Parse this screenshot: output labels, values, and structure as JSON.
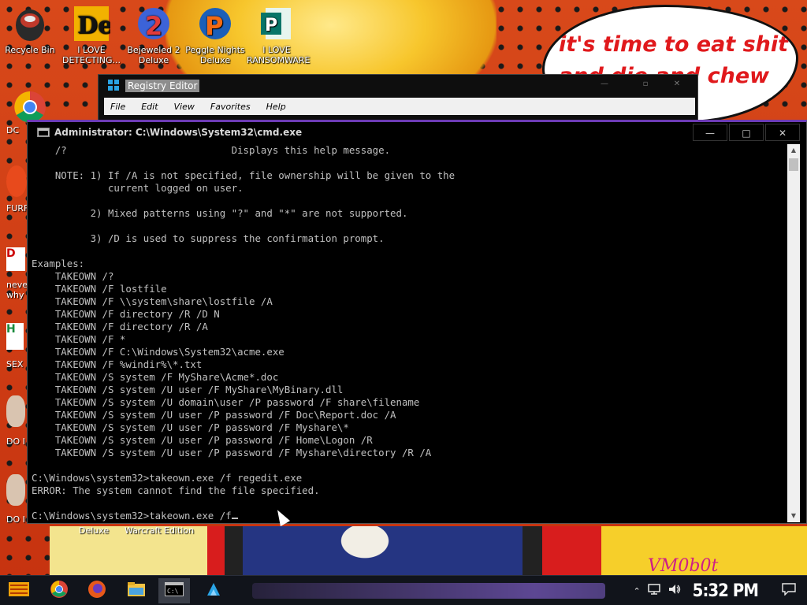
{
  "wallpaper": {
    "speech_text": "it's time to eat shit and die and chew",
    "signature": "VM0b0t",
    "under_labels": [
      "Deluxe",
      "Warcraft Edition"
    ]
  },
  "desktop_icons": [
    {
      "label": "Recycle Bin",
      "icon": "recycle-bin-icon"
    },
    {
      "label": "I LOVE DETECTING...",
      "icon": "detecting-app-icon"
    },
    {
      "label": "Bejeweled 2 Deluxe",
      "icon": "bejeweled-icon"
    },
    {
      "label": "Peggle Nights Deluxe",
      "icon": "peggle-icon"
    },
    {
      "label": "I LOVE RANSOMWARE",
      "icon": "publisher-icon"
    }
  ],
  "partial_icons": [
    "DC",
    "FURF",
    "neve why",
    "SEX",
    "DO I",
    "DO I"
  ],
  "regedit": {
    "title": "Registry Editor",
    "menu": [
      "File",
      "Edit",
      "View",
      "Favorites",
      "Help"
    ]
  },
  "cmd": {
    "title": "Administrator: C:\\Windows\\System32\\cmd.exe",
    "lines": [
      "    /?                            Displays this help message.",
      "",
      "    NOTE: 1) If /A is not specified, file ownership will be given to the",
      "             current logged on user.",
      "",
      "          2) Mixed patterns using \"?\" and \"*\" are not supported.",
      "",
      "          3) /D is used to suppress the confirmation prompt.",
      "",
      "Examples:",
      "    TAKEOWN /?",
      "    TAKEOWN /F lostfile",
      "    TAKEOWN /F \\\\system\\share\\lostfile /A",
      "    TAKEOWN /F directory /R /D N",
      "    TAKEOWN /F directory /R /A",
      "    TAKEOWN /F *",
      "    TAKEOWN /F C:\\Windows\\System32\\acme.exe",
      "    TAKEOWN /F %windir%\\*.txt",
      "    TAKEOWN /S system /F MyShare\\Acme*.doc",
      "    TAKEOWN /S system /U user /F MyShare\\MyBinary.dll",
      "    TAKEOWN /S system /U domain\\user /P password /F share\\filename",
      "    TAKEOWN /S system /U user /P password /F Doc\\Report.doc /A",
      "    TAKEOWN /S system /U user /P password /F Myshare\\*",
      "    TAKEOWN /S system /U user /P password /F Home\\Logon /R",
      "    TAKEOWN /S system /U user /P password /F Myshare\\directory /R /A",
      "",
      "C:\\Windows\\system32>takeown.exe /f regedit.exe",
      "ERROR: The system cannot find the file specified.",
      ""
    ],
    "prompt": "C:\\Windows\\system32>takeown.exe /f"
  },
  "taskbar": {
    "items": [
      {
        "name": "start-button",
        "icon": "start-icon"
      },
      {
        "name": "chrome",
        "icon": "chrome-icon"
      },
      {
        "name": "firefox",
        "icon": "firefox-icon"
      },
      {
        "name": "file-explorer",
        "icon": "folder-icon"
      },
      {
        "name": "cmd",
        "icon": "cmd-icon"
      },
      {
        "name": "regedit",
        "icon": "regedit-icon"
      }
    ],
    "clock": "5:32 PM"
  }
}
